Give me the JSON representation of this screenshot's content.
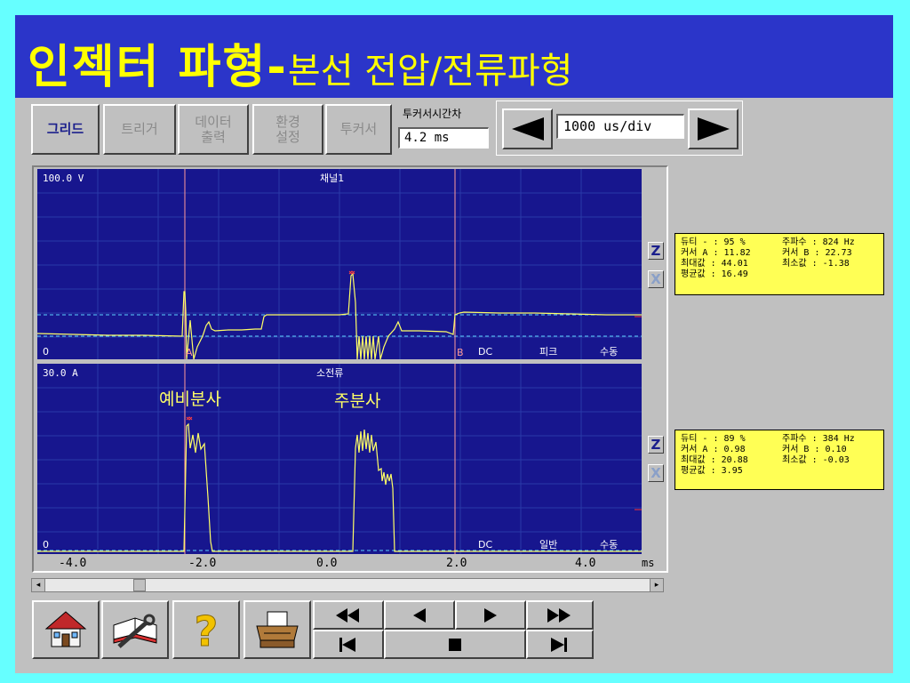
{
  "banner": {
    "title_bold": "인젝터 파형-",
    "title_rest": "본선 전압/전류파형"
  },
  "toolbar": {
    "grid": "그리드",
    "trigger": "트리거",
    "data_output": [
      "데이터",
      "출력"
    ],
    "env_settings": [
      "환경",
      "설정"
    ],
    "two_cursor": "투커서",
    "cursor_diff_label": "투커서시간차",
    "cursor_diff_value": "4.2 ms",
    "timebase": "1000 us/div"
  },
  "channel1": {
    "scale": "100.0 V",
    "name": "채널1",
    "zero": "0",
    "cursor_a": "A",
    "cursor_b": "B",
    "coupling": "DC",
    "mode": "피크",
    "trigger": "수동",
    "info": {
      "duty": "듀티 - : 95 %",
      "freq": "주파수 : 824 Hz",
      "cur_a": "커서 A : 11.82",
      "cur_b": "커서 B : 22.73",
      "max": "최대값 : 44.01",
      "min": "최소값 : -1.38",
      "avg": "평균값 : 16.49"
    }
  },
  "channel2": {
    "scale": "30.0 A",
    "name": "소전류",
    "zero": "0",
    "coupling": "DC",
    "mode": "일반",
    "trigger": "수동",
    "annotation_pilot": "예비분사",
    "annotation_main": "주분사",
    "info": {
      "duty": "듀티 - : 89 %",
      "freq": "주파수 : 384 Hz",
      "cur_a": "커서 A : 0.98",
      "cur_b": "커서 B : 0.10",
      "max": "최대값 : 20.88",
      "min": "최소값 : -0.03",
      "avg": "평균값 : 3.95"
    }
  },
  "x_axis": {
    "ticks": [
      "-4.0",
      "-2.0",
      "0.0",
      "2.0",
      "4.0"
    ],
    "unit": "ms"
  },
  "side_buttons": {
    "zoom": "Z",
    "close": "X"
  },
  "colors": {
    "banner_bg": "#2b35c9",
    "banner_text": "#ffff00",
    "scope_bg": "#17168e",
    "trace": "#ffff66",
    "info_bg": "#ffff55"
  },
  "icons": {
    "home": "home-icon",
    "manual": "manual-tools-icon",
    "help": "question-icon",
    "print": "printer-icon",
    "rewind": "fast-backward-icon",
    "back": "step-back-icon",
    "play": "play-icon",
    "forward": "fast-forward-icon",
    "first": "first-icon",
    "stop": "stop-icon",
    "last": "last-icon"
  }
}
